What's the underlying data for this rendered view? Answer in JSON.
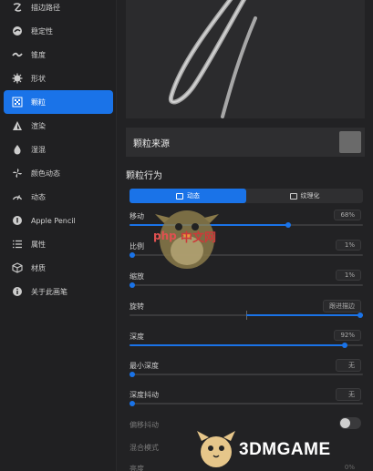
{
  "sidebar": {
    "items": [
      {
        "label": "描边路径",
        "icon": "stroke-path-icon"
      },
      {
        "label": "稳定性",
        "icon": "stabilization-icon"
      },
      {
        "label": "锥度",
        "icon": "taper-icon"
      },
      {
        "label": "形状",
        "icon": "shape-icon"
      },
      {
        "label": "颗粒",
        "icon": "grain-icon",
        "active": true
      },
      {
        "label": "渲染",
        "icon": "render-icon"
      },
      {
        "label": "湿混",
        "icon": "wet-mix-icon"
      },
      {
        "label": "颜色动态",
        "icon": "color-dynamics-icon"
      },
      {
        "label": "动态",
        "icon": "dynamics-icon"
      },
      {
        "label": "Apple Pencil",
        "icon": "apple-pencil-icon"
      },
      {
        "label": "属性",
        "icon": "properties-icon"
      },
      {
        "label": "材质",
        "icon": "materials-icon"
      },
      {
        "label": "关于此画笔",
        "icon": "about-brush-icon"
      }
    ]
  },
  "main": {
    "grain_source_label": "颗粒来源",
    "grain_behavior_title": "颗粒行为",
    "segment": {
      "options": [
        {
          "label": "动态",
          "active": true
        },
        {
          "label": "纹理化",
          "active": false
        }
      ]
    },
    "params": [
      {
        "name": "移动",
        "value": "68%",
        "fraction": 0.68
      },
      {
        "name": "比例",
        "value": "1%",
        "fraction": 0.01
      },
      {
        "name": "缩放",
        "value": "1%",
        "fraction": 0.01
      },
      {
        "name": "旋转",
        "value": "跟进描边",
        "fraction": 1.0,
        "center_origin": true
      },
      {
        "name": "深度",
        "value": "92%",
        "fraction": 0.92
      },
      {
        "name": "最小深度",
        "value": "无",
        "fraction": 0.0
      },
      {
        "name": "深度抖动",
        "value": "无",
        "fraction": 0.0
      }
    ],
    "offset_jitter_label": "偏移抖动",
    "offset_jitter_on": false,
    "blend_mode_label": "混合模式",
    "brightness_label": "亮度",
    "brightness_value": "0%"
  },
  "colors": {
    "accent": "#1a73e8",
    "background": "#222224",
    "sidebar": "#202022"
  },
  "watermarks": {
    "php": "php中文网",
    "game": "3DMGAME"
  }
}
